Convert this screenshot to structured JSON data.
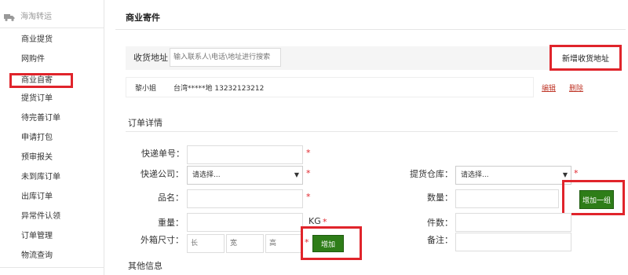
{
  "sidebar": {
    "header": "海淘转运",
    "items": [
      {
        "label": "商业提货"
      },
      {
        "label": "网购件"
      },
      {
        "label": "商业自寄"
      },
      {
        "label": "提货订单"
      },
      {
        "label": "待完善订单"
      },
      {
        "label": "申请打包"
      },
      {
        "label": "预审报关"
      },
      {
        "label": "未到库订单"
      },
      {
        "label": "出库订单"
      },
      {
        "label": "异常件认领"
      },
      {
        "label": "订单管理"
      },
      {
        "label": "物流查询"
      }
    ],
    "active_index": 2
  },
  "main": {
    "title": "商业寄件",
    "address": {
      "label": "收货地址",
      "search_placeholder": "输入联系人\\电话\\地址进行搜索",
      "add_button": "新增收货地址",
      "entry": {
        "name": "黎小姐",
        "detail": "台湾*****地 13232123212",
        "edit": "编辑",
        "delete": "删除"
      }
    },
    "order": {
      "section_title": "订单详情",
      "tracking_label": "快递单号：",
      "courier_label": "快递公司：",
      "courier_value": "请选择...",
      "warehouse_label": "提货仓库：",
      "warehouse_value": "请选择...",
      "product_label": "品名：",
      "quantity_label": "数量：",
      "add_group_button": "增加一组",
      "weight_label": "重量：",
      "weight_unit": "KG",
      "pieces_label": "件数：",
      "size_label": "外箱尺寸：",
      "length_placeholder": "长",
      "width_placeholder": "宽",
      "height_placeholder": "高",
      "add_button": "增加",
      "remark_label": "备注：",
      "required_mark": "*"
    },
    "other_title": "其他信息"
  },
  "colors": {
    "highlight": "#e0242b",
    "button_green": "#2e7d18",
    "link_red": "#c0392b"
  }
}
